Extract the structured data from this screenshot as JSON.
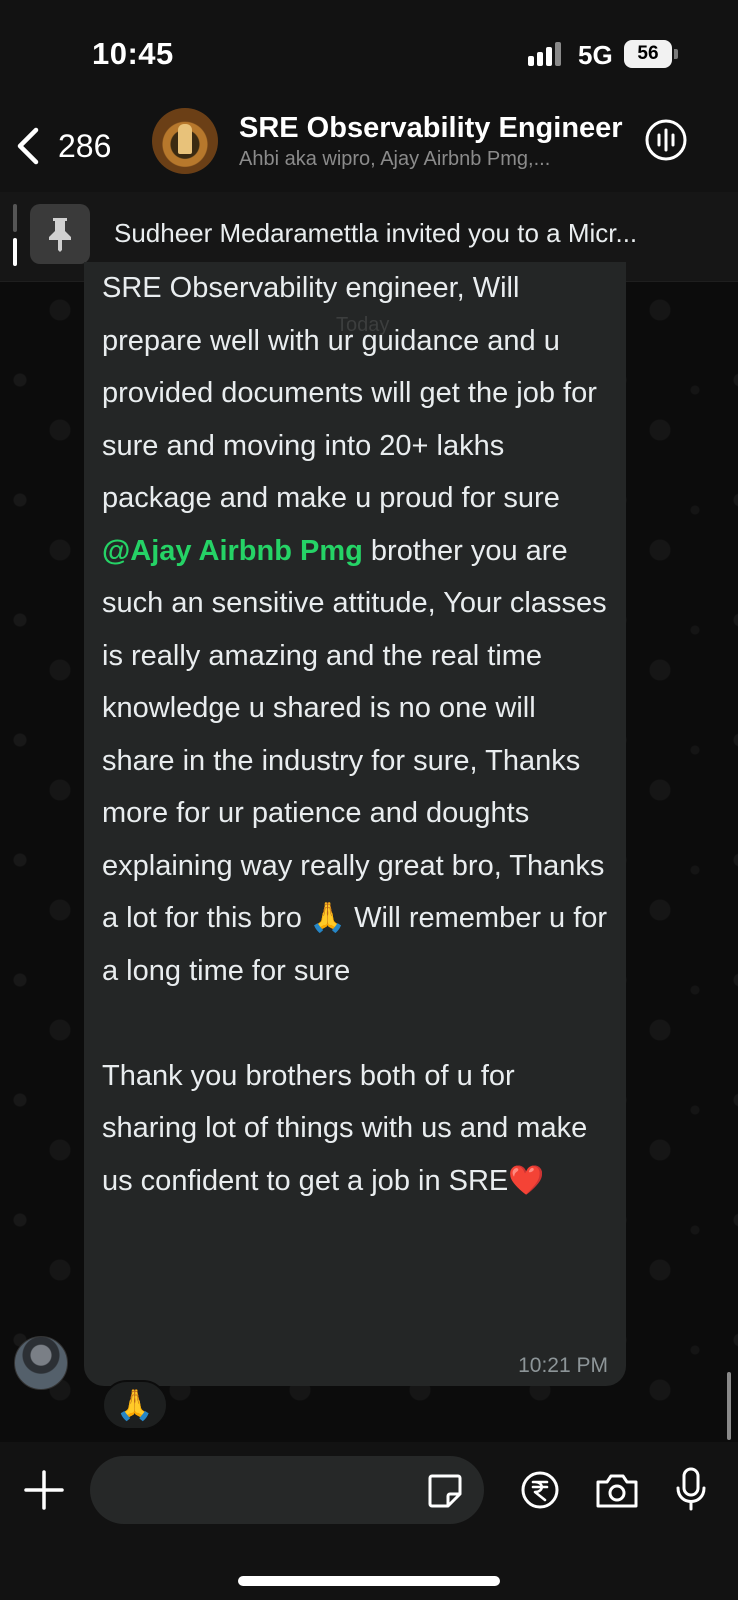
{
  "status_bar": {
    "time": "10:45",
    "network": "5G",
    "battery": "56"
  },
  "header": {
    "back_count": "286",
    "title": "SRE Observability Engineer",
    "subtitle": "Ahbi aka wipro, Ajay Airbnb Pmg,...",
    "icons": {
      "back": "chevron-left-icon",
      "call": "voice-chat-icon"
    }
  },
  "pinned": {
    "text": "Sudheer Medaramettla invited you to a Micr...",
    "icon": "pin-icon"
  },
  "chat": {
    "date_pill": "Today",
    "message": {
      "paragraph1": "SRE Observability engineer, Will prepare well with ur guidance and u provided documents will get the job for sure and moving into 20+ lakhs package and make u proud for sure",
      "mention": "@Ajay Airbnb Pmg",
      "paragraph2": " brother you are such an sensitive attitude, Your classes is really amazing and the real time knowledge u shared is no one will share in the industry for sure, Thanks more for ur patience and doughts explaining way really great bro, Thanks a lot for this bro 🙏 Will remember u for a long time for sure",
      "paragraph3": "Thank you brothers both of u for sharing lot of things with us and make us confident to get a job in SRE❤️",
      "time": "10:21 PM",
      "reaction": "🙏"
    }
  },
  "composer": {
    "input_value": "",
    "icons": {
      "plus": "plus-icon",
      "sticker": "sticker-icon",
      "payment": "rupee-icon",
      "camera": "camera-icon",
      "mic": "microphone-icon"
    }
  },
  "colors": {
    "mention": "#25d366",
    "bubble": "#242626",
    "background": "#0c0c0c"
  }
}
